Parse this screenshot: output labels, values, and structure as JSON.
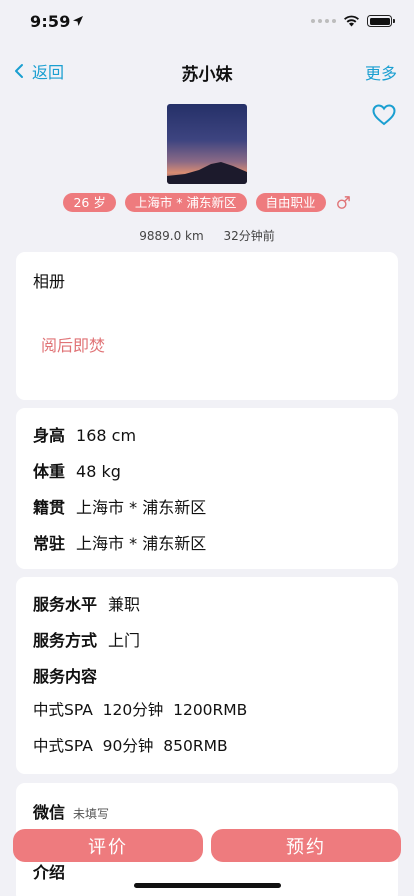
{
  "status": {
    "time": "9:59",
    "icons": [
      "location-arrow-icon",
      "cellular-signal-icon",
      "wifi-icon",
      "battery-icon"
    ],
    "battery_level": 1.0
  },
  "nav": {
    "back_label": "返回",
    "title": "苏小妹",
    "more_label": "更多"
  },
  "profile": {
    "photo": "profile-photo",
    "tags": [
      "26 岁",
      "上海市 * 浦东新区",
      "自由职业"
    ],
    "gender_icon": "male-icon",
    "distance": "9889.0 km",
    "last_seen": "32分钟前",
    "favorite_icon": "heart-outline-icon"
  },
  "album": {
    "title": "相册",
    "burn_link": "阅后即焚"
  },
  "info": {
    "rows": [
      {
        "key": "身高",
        "value": "168 cm"
      },
      {
        "key": "体重",
        "value": "48 kg"
      },
      {
        "key": "籍贯",
        "value": "上海市 * 浦东新区"
      },
      {
        "key": "常驻",
        "value": "上海市 * 浦东新区"
      }
    ]
  },
  "service": {
    "level": {
      "key": "服务水平",
      "value": "兼职"
    },
    "method": {
      "key": "服务方式",
      "value": "上门"
    },
    "content_key": "服务内容",
    "items": [
      "中式SPA  120分钟  1200RMB",
      "中式SPA  90分钟  850RMB"
    ]
  },
  "contact": {
    "wechat_key": "微信",
    "wechat_value": "未填写",
    "intro_key": "介绍"
  },
  "actions": {
    "review_label": "评价",
    "book_label": "预约"
  },
  "colors": {
    "accent": "#1a9fd1",
    "tag": "#ee7b7e",
    "background": "#f1f1f6"
  }
}
